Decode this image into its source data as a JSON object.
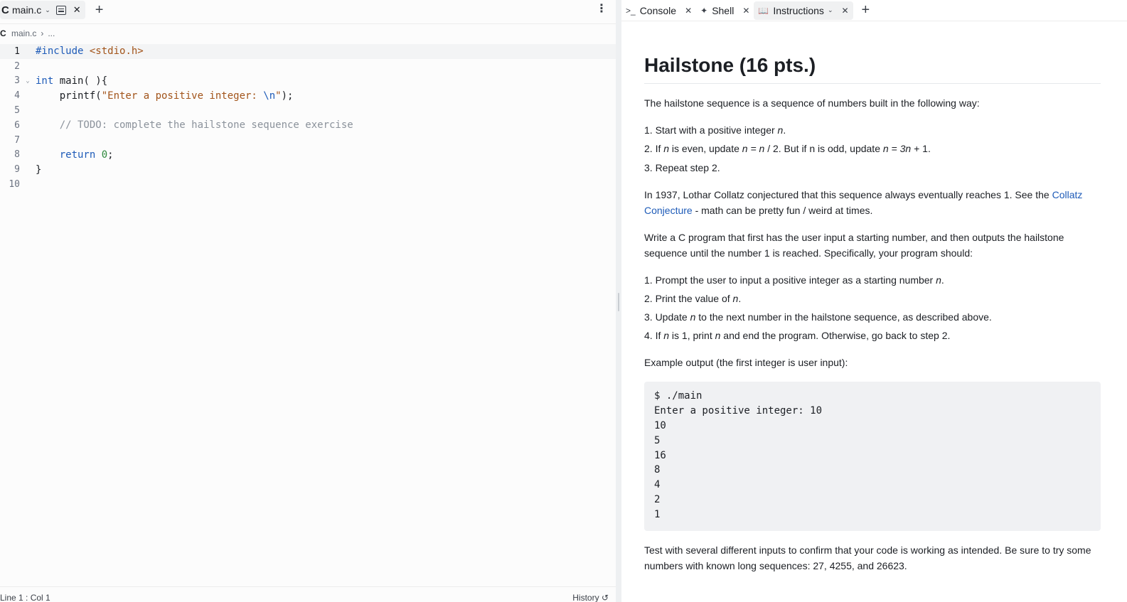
{
  "editor": {
    "tab": {
      "lang": "C",
      "name": "main.c"
    },
    "breadcrumb": {
      "lang": "C",
      "file": "main.c",
      "more": "..."
    },
    "code_lines": [
      {
        "n": "1",
        "parts": [
          {
            "c": "kw",
            "t": "#include"
          },
          {
            "c": "",
            "t": " "
          },
          {
            "c": "str",
            "t": "<stdio.h>"
          }
        ]
      },
      {
        "n": "2",
        "parts": []
      },
      {
        "n": "3",
        "parts": [
          {
            "c": "kw",
            "t": "int"
          },
          {
            "c": "",
            "t": " main( ){"
          }
        ]
      },
      {
        "n": "4",
        "parts": [
          {
            "c": "",
            "t": "    printf("
          },
          {
            "c": "str",
            "t": "\"Enter a positive integer: "
          },
          {
            "c": "kw",
            "t": "\\n"
          },
          {
            "c": "str",
            "t": "\""
          },
          {
            "c": "",
            "t": ");"
          }
        ]
      },
      {
        "n": "5",
        "parts": []
      },
      {
        "n": "6",
        "parts": [
          {
            "c": "cmt",
            "t": "    // TODO: complete the hailstone sequence exercise"
          }
        ]
      },
      {
        "n": "7",
        "parts": []
      },
      {
        "n": "8",
        "parts": [
          {
            "c": "",
            "t": "    "
          },
          {
            "c": "kw",
            "t": "return"
          },
          {
            "c": "",
            "t": " "
          },
          {
            "c": "num",
            "t": "0"
          },
          {
            "c": "",
            "t": ";"
          }
        ]
      },
      {
        "n": "9",
        "parts": [
          {
            "c": "",
            "t": "}"
          }
        ]
      },
      {
        "n": "10",
        "parts": []
      }
    ],
    "status": {
      "position": "Line 1 : Col 1",
      "history": "History"
    }
  },
  "panel": {
    "tabs": [
      {
        "icon": ">_",
        "label": "Console"
      },
      {
        "icon": "shell",
        "label": "Shell"
      },
      {
        "icon": "book",
        "label": "Instructions"
      }
    ],
    "doc": {
      "title": "Hailstone (16 pts.)",
      "intro": "The hailstone sequence is a sequence of numbers built in the following way:",
      "rules": [
        "1. Start with a positive integer <em>n</em>.",
        "2. If <em>n</em> is even, update <em>n = n</em> / 2. But if n is odd, update <em>n = 3n</em> + 1.",
        "3. Repeat step 2."
      ],
      "collatz_before": "In 1937, Lothar Collatz conjectured that this sequence always eventually reaches 1. See the ",
      "collatz_link": "Collatz Conjecture",
      "collatz_after": " - math can be pretty fun / weird at times.",
      "task": "Write a C program that first has the user input a starting number, and then outputs the hailstone sequence until the number 1 is reached. Specifically, your program should:",
      "steps": [
        "1. Prompt the user to input a positive integer as a starting number <em>n</em>.",
        "2. Print the value of <em>n</em>.",
        "3. Update <em>n</em> to the next number in the hailstone sequence, as described above.",
        "4. If <em>n</em> is 1, print <em>n</em> and end the program. Otherwise, go back to step 2."
      ],
      "example_label": "Example output (the first integer is user input):",
      "example_output": "$ ./main\nEnter a positive integer: 10\n10\n5\n16\n8\n4\n2\n1",
      "footer": "Test with several different inputs to confirm that your code is working as intended. Be sure to try some numbers with known long sequences: 27, 4255, and 26623."
    }
  }
}
